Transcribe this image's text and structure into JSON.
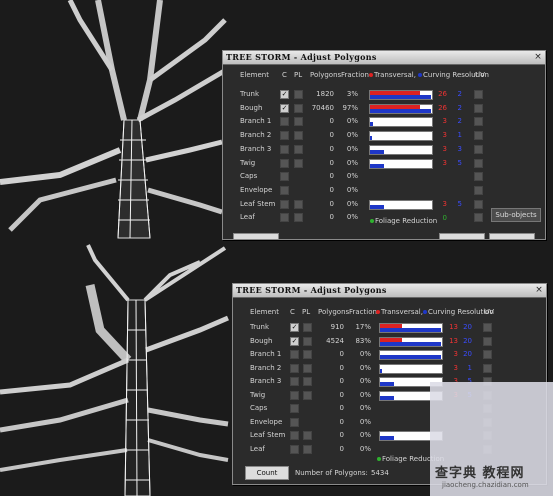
{
  "dialog_top": {
    "title": "TREE STORM - Adjust Polygons",
    "close_glyph": "×",
    "headers": {
      "element": "Element",
      "c": "C",
      "pl": "PL",
      "polygons": "Polygons",
      "fraction": "Fraction",
      "transversal": "Transversal,",
      "curving": "Curving Resolution",
      "uv": "UV"
    },
    "rows": [
      {
        "element": "Trunk",
        "c": true,
        "pl": false,
        "polygons": "1820",
        "fraction": "3%",
        "red": 0.8,
        "blue": 0.98,
        "rv": "26",
        "bv": "2"
      },
      {
        "element": "Bough",
        "c": true,
        "pl": false,
        "polygons": "70460",
        "fraction": "97%",
        "red": 0.8,
        "blue": 0.98,
        "rv": "26",
        "bv": "2"
      },
      {
        "element": "Branch 1",
        "c": false,
        "pl": false,
        "polygons": "0",
        "fraction": "0%",
        "red": 0,
        "blue": 0.05,
        "rv": "3",
        "bv": "2"
      },
      {
        "element": "Branch 2",
        "c": false,
        "pl": false,
        "polygons": "0",
        "fraction": "0%",
        "red": 0,
        "blue": 0.03,
        "rv": "3",
        "bv": "1"
      },
      {
        "element": "Branch 3",
        "c": false,
        "pl": false,
        "polygons": "0",
        "fraction": "0%",
        "red": 0,
        "blue": 0.22,
        "rv": "3",
        "bv": "3"
      },
      {
        "element": "Twig",
        "c": false,
        "pl": false,
        "polygons": "0",
        "fraction": "0%",
        "red": 0,
        "blue": 0.22,
        "rv": "3",
        "bv": "5"
      },
      {
        "element": "Caps",
        "c": false,
        "pl": null,
        "polygons": "0",
        "fraction": "0%",
        "red": null,
        "blue": null,
        "rv": "",
        "bv": ""
      },
      {
        "element": "Envelope",
        "c": false,
        "pl": null,
        "polygons": "0",
        "fraction": "0%",
        "red": null,
        "blue": null,
        "rv": "",
        "bv": ""
      },
      {
        "element": "Leaf Stem",
        "c": false,
        "pl": false,
        "polygons": "0",
        "fraction": "0%",
        "red": 0,
        "blue": 0.22,
        "rv": "3",
        "bv": "5"
      },
      {
        "element": "Leaf",
        "c": false,
        "pl": false,
        "polygons": "0",
        "fraction": "0%",
        "red": null,
        "blue": null,
        "rv": "",
        "bv": "",
        "gv": "0"
      }
    ],
    "foliage_label": "Foliage Reduction",
    "subobjects_label": "Sub-objects"
  },
  "dialog_bottom": {
    "title": "TREE STORM - Adjust Polygons",
    "close_glyph": "×",
    "headers": {
      "element": "Element",
      "c": "C",
      "pl": "PL",
      "polygons": "Polygons",
      "fraction": "Fraction",
      "transversal": "Transversal,",
      "curving": "Curving Resolution",
      "uv": "UV"
    },
    "rows": [
      {
        "element": "Trunk",
        "c": true,
        "pl": false,
        "polygons": "910",
        "fraction": "17%",
        "red": 0.35,
        "blue": 0.98,
        "rv": "13",
        "bv": "20"
      },
      {
        "element": "Bough",
        "c": true,
        "pl": false,
        "polygons": "4524",
        "fraction": "83%",
        "red": 0.35,
        "blue": 0.98,
        "rv": "13",
        "bv": "20"
      },
      {
        "element": "Branch 1",
        "c": false,
        "pl": false,
        "polygons": "0",
        "fraction": "0%",
        "red": 0,
        "blue": 0.98,
        "rv": "3",
        "bv": "20"
      },
      {
        "element": "Branch 2",
        "c": false,
        "pl": false,
        "polygons": "0",
        "fraction": "0%",
        "red": 0,
        "blue": 0.03,
        "rv": "3",
        "bv": "1"
      },
      {
        "element": "Branch 3",
        "c": false,
        "pl": false,
        "polygons": "0",
        "fraction": "0%",
        "red": 0,
        "blue": 0.22,
        "rv": "3",
        "bv": "5"
      },
      {
        "element": "Twig",
        "c": false,
        "pl": false,
        "polygons": "0",
        "fraction": "0%",
        "red": 0,
        "blue": 0.22,
        "rv": "3",
        "bv": "5"
      },
      {
        "element": "Caps",
        "c": false,
        "pl": null,
        "polygons": "0",
        "fraction": "0%",
        "red": null,
        "blue": null,
        "rv": "",
        "bv": ""
      },
      {
        "element": "Envelope",
        "c": false,
        "pl": null,
        "polygons": "0",
        "fraction": "0%",
        "red": null,
        "blue": null,
        "rv": "",
        "bv": ""
      },
      {
        "element": "Leaf Stem",
        "c": false,
        "pl": false,
        "polygons": "0",
        "fraction": "0%",
        "red": 0,
        "blue": 0.22,
        "rv": "",
        "bv": ""
      },
      {
        "element": "Leaf",
        "c": false,
        "pl": false,
        "polygons": "0",
        "fraction": "0%",
        "red": null,
        "blue": null,
        "rv": "",
        "bv": ""
      }
    ],
    "foliage_label": "Foliage Reduction",
    "count_label": "Count",
    "num_polygons_label": "Number of Polygons:",
    "num_polygons_value": "5434"
  },
  "watermark": {
    "main": "查字典 教程网",
    "url": "jiaocheng.chazidian.com"
  },
  "colors": {
    "background": "#1b1b1b",
    "dialog": "#2b2b2b",
    "transversal": "#d22222",
    "curving": "#1e37c8",
    "foliage": "#2fb12f"
  }
}
